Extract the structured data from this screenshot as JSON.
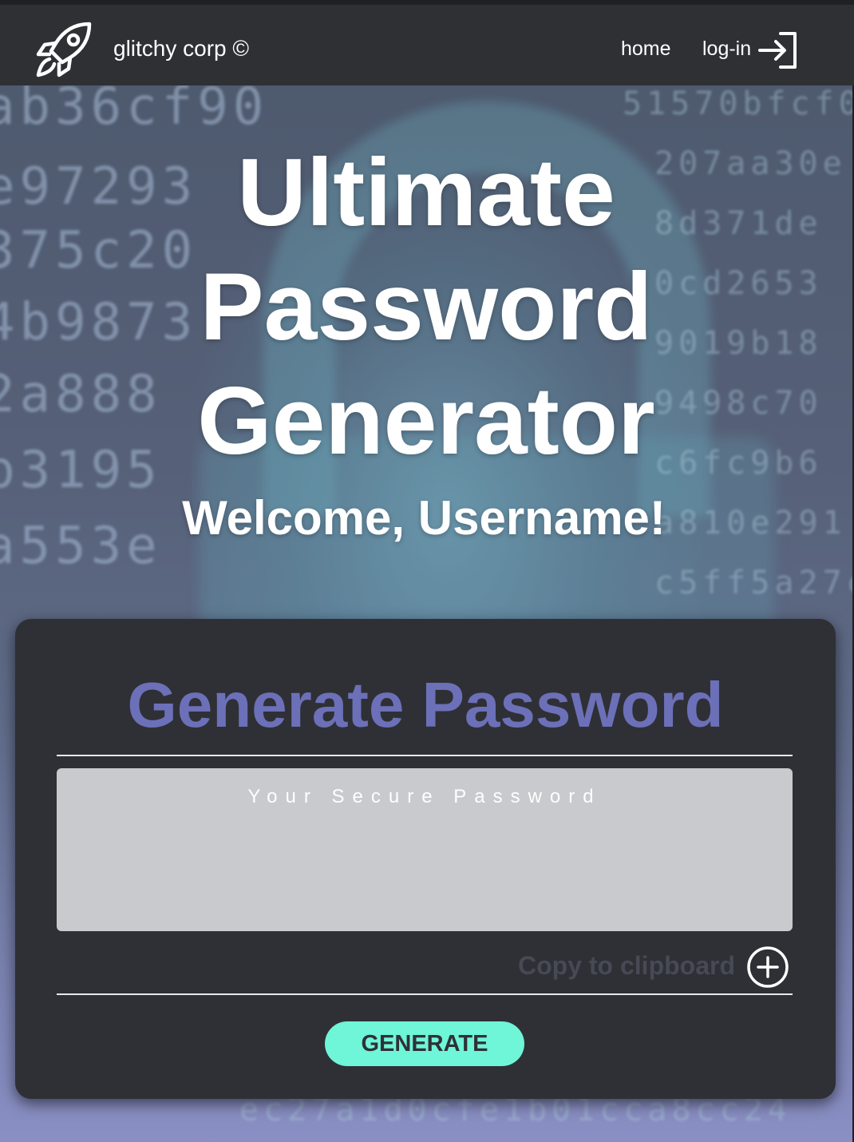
{
  "header": {
    "brand": "glitchy corp ©",
    "nav_home": "home",
    "nav_login": "log-in",
    "logo_icon": "rocket-icon",
    "login_icon": "log-in-arrow-icon"
  },
  "hero": {
    "title_lines": [
      "Ultimate",
      "Password",
      "Generator"
    ],
    "welcome": "Welcome, Username!"
  },
  "generator": {
    "title": "Generate Password",
    "password_placeholder": "Your Secure Password",
    "password_value": "",
    "copy_label": "Copy to clipboard",
    "copy_icon": "plus-circle-icon",
    "generate_label": "GENERATE"
  },
  "colors": {
    "topbar": "#2f3034",
    "card": "#2f3035",
    "card_title": "#6c70b8",
    "password_box": "#c9cacd",
    "generate_button": "#6ff5d8",
    "copy_label": "#464a55"
  },
  "background": {
    "description_text_rows": [
      "ab36cf90ab5e3da5143f9da6e207aa3",
      "e9729305a7e7350d77ea452a0cd2653",
      "375c2011d34c4d472e50bd472e019b1",
      "4b98739b4cd472e50b0b1b049498c70",
      "2a888ab31da72e9b1bbb12b1949bc7",
      "b3195e1bb37170f0b8e0f1a810e291",
      "a553eb77a5d670d112d670dc5ff5a27c"
    ]
  }
}
